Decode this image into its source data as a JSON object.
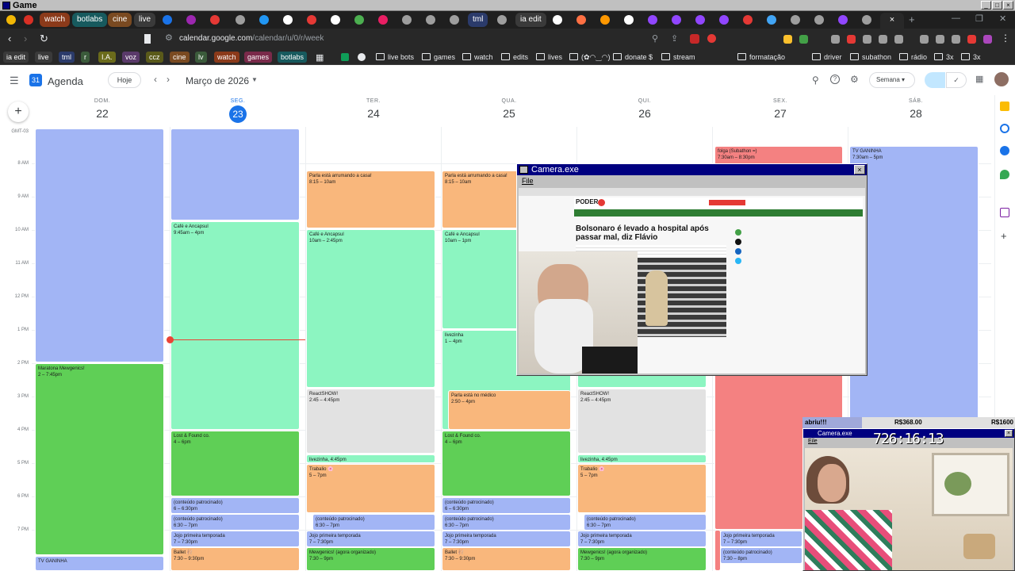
{
  "os": {
    "title": "Game"
  },
  "tabs": {
    "pinned": [
      "watch",
      "botlabs",
      "cine",
      "live",
      "tml",
      "ia edit"
    ]
  },
  "address": {
    "host": "calendar.google.com",
    "path": "/calendar/u/0/r/week"
  },
  "bookmarks": {
    "chips": [
      "ia edit",
      "live",
      "tml",
      "r",
      "I.A.",
      "voz",
      "ccz",
      "cine",
      "lv",
      "watch",
      "games",
      "botlabs"
    ],
    "folders": [
      "live bots",
      "games",
      "watch",
      "edits",
      "lives",
      "(✿◠‿◠)",
      "donate $",
      "stream",
      "formatação",
      "driver",
      "subathon",
      "rádio",
      "3x",
      "3x"
    ]
  },
  "calendar": {
    "app_name": "Agenda",
    "today_button": "Hoje",
    "month_label": "Março de 2026",
    "view_select": "Semana",
    "timezone": "GMT-03",
    "days": [
      {
        "name": "DOM.",
        "num": "22"
      },
      {
        "name": "SEG.",
        "num": "23"
      },
      {
        "name": "TER.",
        "num": "24"
      },
      {
        "name": "QUA.",
        "num": "25"
      },
      {
        "name": "QUI.",
        "num": "26"
      },
      {
        "name": "SEX.",
        "num": "27"
      },
      {
        "name": "SÁB.",
        "num": "28"
      }
    ],
    "hours": [
      "8 AM",
      "9 AM",
      "10 AM",
      "11 AM",
      "12 PM",
      "1 PM",
      "2 PM",
      "3 PM",
      "4 PM",
      "5 PM",
      "6 PM",
      "7 PM"
    ],
    "events": {
      "e1": {
        "title": "Maratona Mewgenics!",
        "time": "2 – 7:45pm"
      },
      "e2": {
        "title": "TV GANINHA",
        "time": ""
      },
      "e3": {
        "title": "Café e Ancapsul",
        "time": "9:45am – 4pm"
      },
      "e4": {
        "title": "Lost & Found co.",
        "time": "4 – 6pm"
      },
      "e5": {
        "title": "(conteúdo patrocinado)",
        "time": "6 – 6:30pm"
      },
      "e6": {
        "title": "(conteúdo patrocinado)",
        "time": "6:30 – 7pm"
      },
      "e7": {
        "title": "Jojo primeira temporada",
        "time": "7 – 7:30pm"
      },
      "e8": {
        "title": "Ballet 🩰",
        "time": "7:30 – 9:30pm"
      },
      "e9": {
        "title": "Parla está arrumando a casa!",
        "time": "8:15 – 10am"
      },
      "e10": {
        "title": "Café e Ancapsul",
        "time": "10am – 2:45pm"
      },
      "e11": {
        "title": "ReactSHOW!",
        "time": "2:45 – 4:45pm"
      },
      "e12": {
        "title": "livezinha, 4:45pm",
        "time": ""
      },
      "e13": {
        "title": "Trabalio 🌸",
        "time": "5 – 7pm"
      },
      "e14": {
        "title": "(conteúdo patrocinado)",
        "time": "6:30 – 7pm"
      },
      "e15": {
        "title": "Jojo primeira temporada",
        "time": "7 – 7:30pm"
      },
      "e16": {
        "title": "Mewgenics! (agora organizado)",
        "time": "7:30 – 9pm"
      },
      "e17": {
        "title": "Parla está arrumando a casa!",
        "time": "8:15 – 10am"
      },
      "e18": {
        "title": "Café e Ancapsul",
        "time": "10am – 1pm"
      },
      "e19": {
        "title": "livezinha",
        "time": "1 – 4pm"
      },
      "e20": {
        "title": "Parla está no médico",
        "time": "2:50 – 4pm"
      },
      "e21": {
        "title": "Lost & Found co.",
        "time": "4 – 6pm"
      },
      "e22": {
        "title": "(conteúdo patrocinado)",
        "time": "6 – 6:30pm"
      },
      "e23": {
        "title": "(conteúdo patrocinado)",
        "time": "6:30 – 7pm"
      },
      "e24": {
        "title": "Jojo primeira temporada",
        "time": "7 – 7:30pm"
      },
      "e25": {
        "title": "Ballet 🩰",
        "time": "7:30 – 9:30pm"
      },
      "e26": {
        "title": "ReactSHOW!",
        "time": "2:45 – 4:45pm"
      },
      "e27": {
        "title": "livezinha, 4:45pm",
        "time": ""
      },
      "e28": {
        "title": "Trabalio 🌸",
        "time": "5 – 7pm"
      },
      "e29": {
        "title": "(conteúdo patrocinado)",
        "time": "6:30 – 7pm"
      },
      "e30": {
        "title": "Jojo primeira temporada",
        "time": "7 – 7:30pm"
      },
      "e31": {
        "title": "Mewgenics! (agora organizado)",
        "time": "7:30 – 9pm"
      },
      "e32": {
        "title": "folga (Subathon =)",
        "time": "7:30am – 8:30pm"
      },
      "e33": {
        "title": "Jojo primeira temporada",
        "time": "7 – 7:30pm"
      },
      "e34": {
        "title": "(conteúdo patrocinado)",
        "time": "7:30 – 8pm"
      },
      "e35": {
        "title": "TV GANINHA",
        "time": "7:30am – 5pm"
      }
    }
  },
  "camera_window": {
    "title": "Camera.exe",
    "menu": "File",
    "article": {
      "site": "PODER",
      "headline": "Bolsonaro é levado a hospital após passar mal, diz Flávio"
    }
  },
  "overlay": {
    "left_label": "abriu!!!",
    "mid_value": "R$368.00",
    "right_value": "R$1600",
    "window_title": "Camera.exe",
    "menu": "Eile",
    "timer": "726:16:13"
  }
}
